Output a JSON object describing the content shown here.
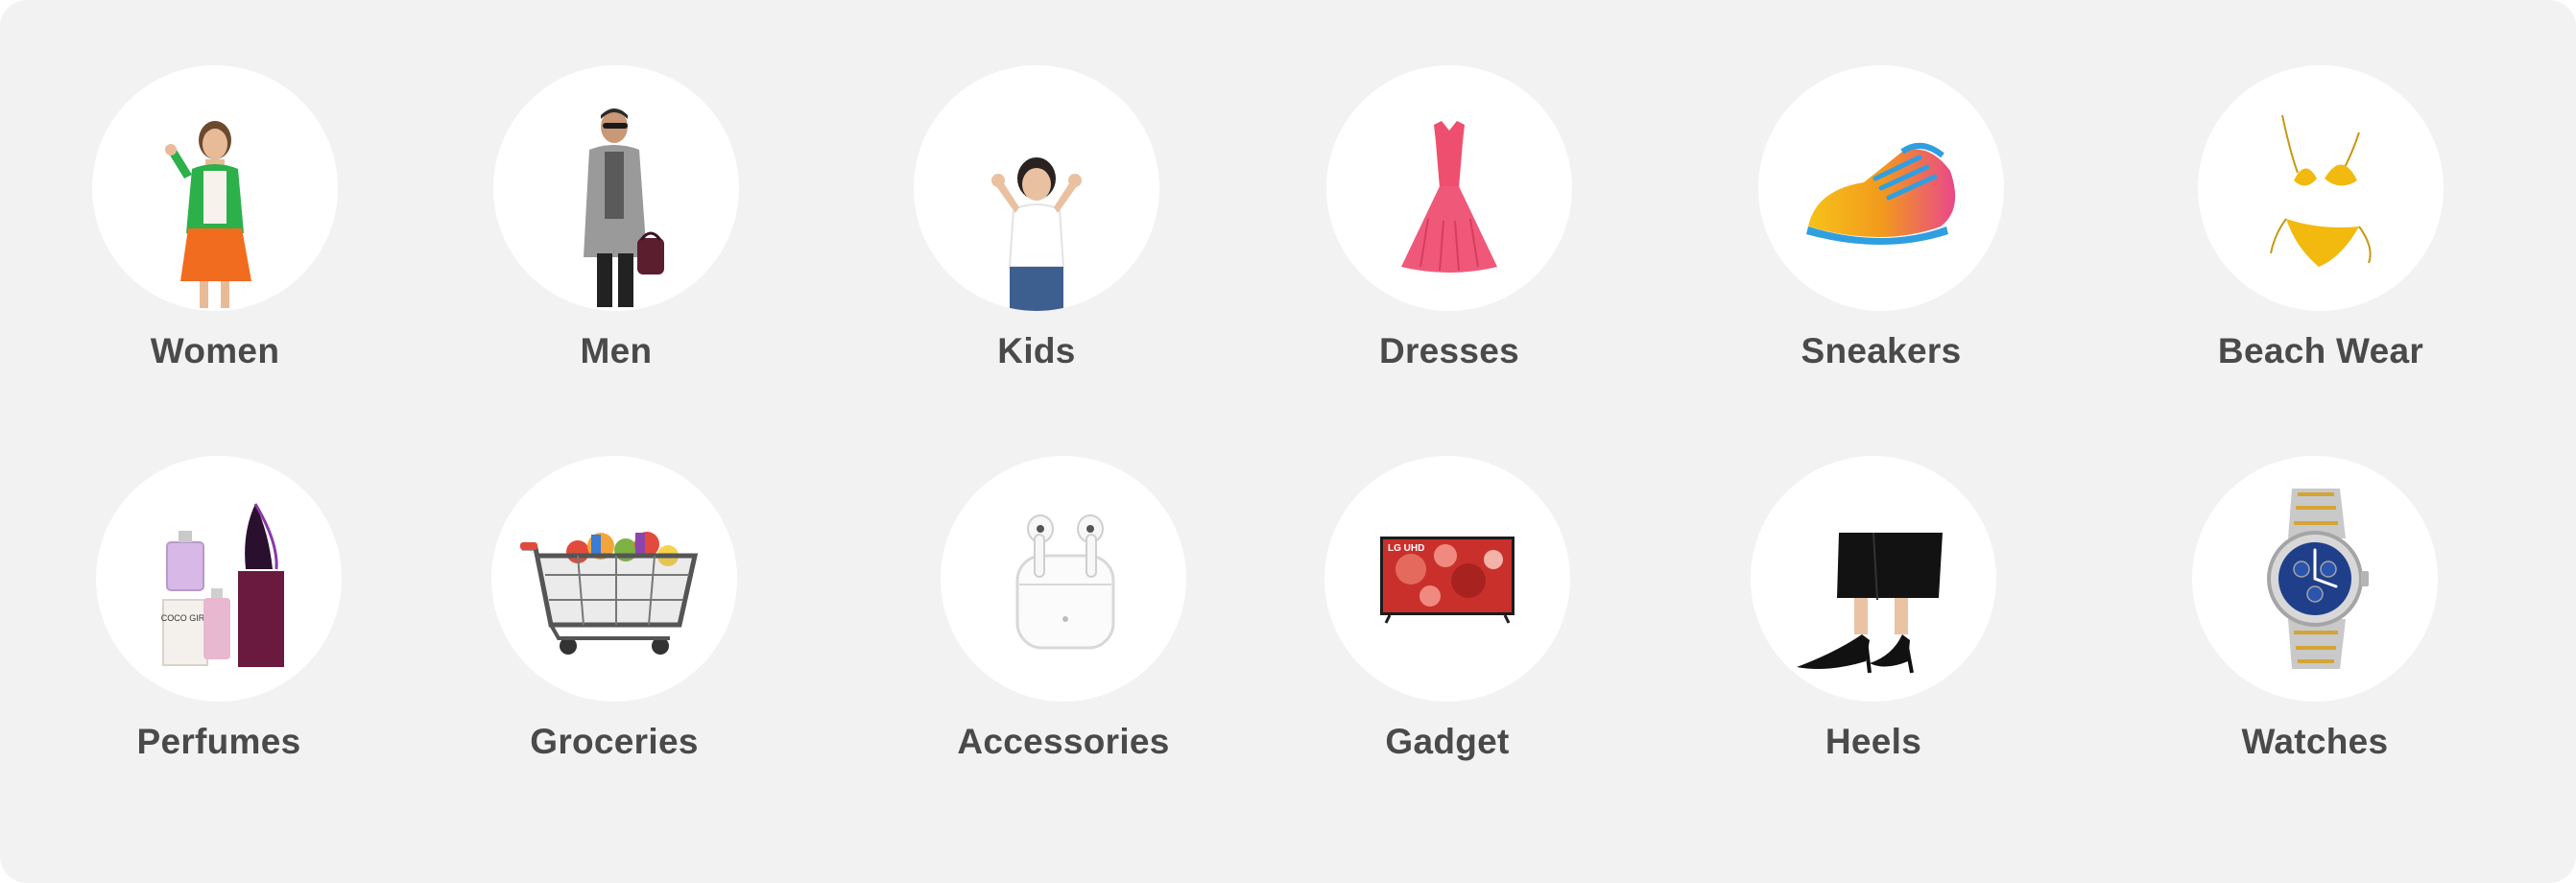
{
  "categories": {
    "row1": [
      {
        "label": "Women",
        "icon": "woman-icon"
      },
      {
        "label": "Men",
        "icon": "man-icon"
      },
      {
        "label": "Kids",
        "icon": "kid-icon"
      },
      {
        "label": "Dresses",
        "icon": "dress-icon"
      },
      {
        "label": "Sneakers",
        "icon": "sneaker-icon"
      },
      {
        "label": "Beach Wear",
        "icon": "bikini-icon"
      }
    ],
    "row2": [
      {
        "label": "Perfumes",
        "icon": "perfume-icon"
      },
      {
        "label": "Groceries",
        "icon": "shopping-cart-icon"
      },
      {
        "label": "Accessories",
        "icon": "earbuds-icon"
      },
      {
        "label": "Gadget",
        "icon": "television-icon"
      },
      {
        "label": "Heels",
        "icon": "heels-icon"
      },
      {
        "label": "Watches",
        "icon": "watch-icon"
      }
    ]
  },
  "gadget_tv_brand": "LG UHD",
  "perfume_box_text": "COCO GIRL",
  "colors": {
    "panel_background": "#f2f2f2",
    "circle_background": "#ffffff",
    "label_text": "#4a4a4a"
  }
}
